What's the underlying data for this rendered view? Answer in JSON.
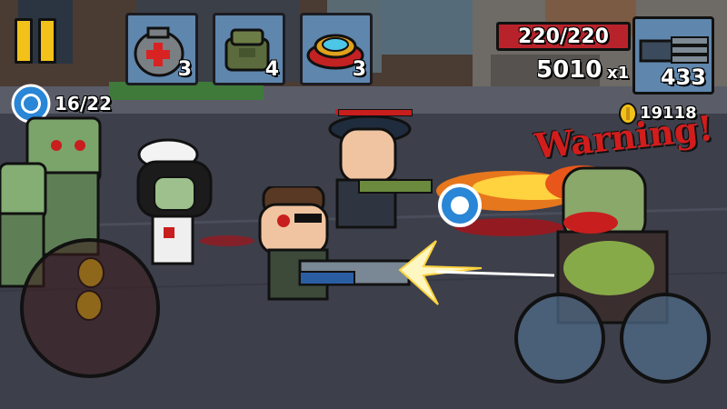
{
  "hud": {
    "items": [
      {
        "icon": "medkit-icon",
        "count": "3"
      },
      {
        "icon": "grenade-bag-icon",
        "count": "4"
      },
      {
        "icon": "landmine-icon",
        "count": "3"
      }
    ],
    "player_health": "220/220",
    "score": "5010",
    "multiplier": "x1",
    "ammo": "433",
    "coins": "19118",
    "chips": "16/22"
  },
  "warning_text": "Warning!",
  "colors": {
    "health_bar": "#b8232b",
    "slot_bg": "#5f86ad",
    "pause": "#f2c21a",
    "chip": "#2a86d6",
    "coin": "#f2c21a"
  }
}
